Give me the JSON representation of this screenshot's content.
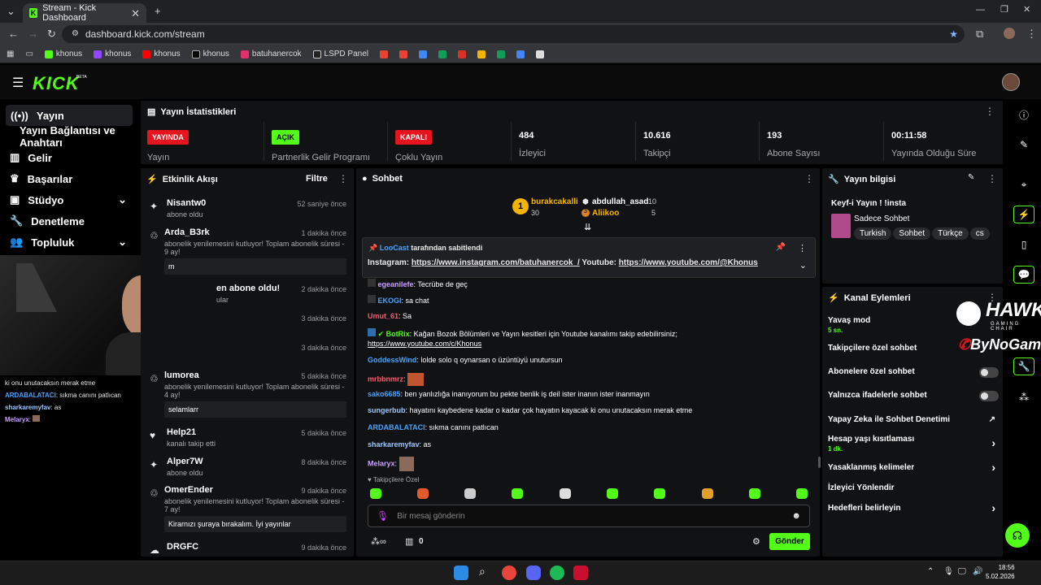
{
  "browser": {
    "tab_title": "Stream - Kick Dashboard",
    "url": "dashboard.kick.com/stream",
    "bookmarks": [
      "khonus",
      "khonus",
      "khonus",
      "khonus",
      "batuhanercok",
      "LSPD Panel"
    ]
  },
  "header": {
    "logo": "KICK",
    "beta": "BETA"
  },
  "sidebar": {
    "items": [
      {
        "label": "Yayın",
        "icon": "broadcast-icon"
      },
      {
        "label": "Yayın Bağlantısı ve Anahtarı",
        "icon": ""
      },
      {
        "label": "Gelir",
        "icon": "revenue-icon"
      },
      {
        "label": "Başarılar",
        "icon": "trophy-icon"
      },
      {
        "label": "Stüdyo",
        "icon": "studio-icon"
      },
      {
        "label": "Denetleme",
        "icon": "wrench-icon"
      },
      {
        "label": "Topluluk",
        "icon": "people-icon"
      }
    ],
    "overlay_chat": [
      {
        "user": "",
        "msg": "ki onu unutacaksın merak etme",
        "color": "#ffffff"
      },
      {
        "user": "ARDABALATACI",
        "msg": ": sıkma canını patlıcan",
        "color": "#4aa3ff"
      },
      {
        "user": "sharkaremyfav",
        "msg": ": as",
        "color": "#9ec7ff"
      },
      {
        "user": "Melaryx",
        "msg": ":",
        "color": "#c9a0ff"
      }
    ]
  },
  "stats": {
    "title": "Yayın İstatistikleri",
    "cells": [
      {
        "badge": "YAYINDA",
        "label": "Yayın",
        "badge_color": "#e5141f"
      },
      {
        "badge": "AÇIK",
        "label": "Partnerlik Gelir Programı",
        "badge_color": "#53fc18"
      },
      {
        "badge": "KAPALI",
        "label": "Çoklu Yayın",
        "badge_color": "#e5141f"
      },
      {
        "value": "484",
        "label": "İzleyici"
      },
      {
        "value": "10.616",
        "label": "Takipçi"
      },
      {
        "value": "193",
        "label": "Abone Sayısı"
      },
      {
        "value": "00:11:58",
        "label": "Yayında Olduğu Süre"
      }
    ]
  },
  "activity": {
    "title": "Etkinlik Akışı",
    "filter": "Filtre",
    "items": [
      {
        "name": "Nisantw0",
        "sub": "abone oldu",
        "time": "52 saniye önce"
      },
      {
        "name": "Arda_B3rk",
        "sub": "abonelik yenilemesini kutluyor! Toplam abonelik süresi - 9 ay!",
        "time": "1 dakika önce",
        "quote": "m"
      },
      {
        "name": "en abone oldu!",
        "sub": "ular",
        "time": "2 dakika önce"
      },
      {
        "name": "",
        "sub": "",
        "time": "3 dakika önce"
      },
      {
        "name": "",
        "sub": "",
        "time": "3 dakika önce"
      },
      {
        "name": "lumorea",
        "sub": "abonelik yenilemesini kutluyor! Toplam abonelik süresi - 4 ay!",
        "time": "5 dakika önce",
        "quote": "selamlarr"
      },
      {
        "name": "Help21",
        "sub": "kanalı takip etti",
        "time": "5 dakika önce"
      },
      {
        "name": "Alper7W",
        "sub": "abone oldu",
        "time": "8 dakika önce"
      },
      {
        "name": "OmerEnder",
        "sub": "abonelik yenilemesini kutluyor! Toplam abonelik süresi - 7 ay!",
        "time": "9 dakika önce",
        "quote": "Kirarnızı şuraya bırakalım. İyi yayınlar"
      },
      {
        "name": "DRGFC",
        "sub": "",
        "time": "9 dakika önce"
      }
    ]
  },
  "chat": {
    "title": "Sohbet",
    "leaders": [
      {
        "name": "burakcakalli",
        "count": "30",
        "rank": "1"
      },
      {
        "name": "abdullah_asad",
        "count": "10",
        "rank": ""
      },
      {
        "name": "Aliikoo",
        "count": "5",
        "rank": "3"
      }
    ],
    "pinned": {
      "by_user": "LooCast",
      "by_text": "tarafından sabitlendi",
      "prefix": "Instagram:",
      "link1": "https://www.instagram.com/batuhanercok_/",
      "mid": "Youtube:",
      "link2": "https://www.youtube.com/@Khonus"
    },
    "messages": [
      {
        "user": "egeanilefe",
        "text": ": Tecrübe de geç",
        "color": "#c9a0ff"
      },
      {
        "user": "EKOGI",
        "text": ": sa chat",
        "color": "#4aa3ff"
      },
      {
        "user": "Umut_61",
        "text": ": Sa",
        "color": "#ff5a6e"
      },
      {
        "user": "BotRix",
        "text": ": Kağan Bozok Bölümleri ve Yayın kesitleri için Youtube kanalımı takip edebilirsiniz;",
        "color": "#53fc18"
      },
      {
        "user": "",
        "text": "https://www.youtube.com/c/Khonus",
        "color": "#ffffff"
      },
      {
        "user": "GoddessWind",
        "text": ": lolde solo q oynarsan o üzüntüyü unutursun",
        "color": "#4aa3ff"
      },
      {
        "user": "mrbbnmrz",
        "text": ":",
        "color": "#ff5a6e"
      },
      {
        "user": "sako6685",
        "text": ": ben yanlızlığa inanıyorum bu pekte benlik iş deil ister inanın ister inanmayın",
        "color": "#4aa3ff"
      },
      {
        "user": "sungerbub",
        "text": ": hayatını kaybedene kadar o kadar çok hayatın kayacak ki onu unutacaksın merak etme",
        "color": "#9ec7ff"
      },
      {
        "user": "ARDABALATACI",
        "text": ": sıkma canını patlıcan",
        "color": "#4aa3ff"
      },
      {
        "user": "sharkaremyfav",
        "text": ": as",
        "color": "#9ec7ff"
      },
      {
        "user": "Melaryx",
        "text": ":",
        "color": "#c9a0ff"
      }
    ],
    "followers_only": "Takipçilere Özel",
    "input_placeholder": "Bir mesaj gönderin",
    "points": "0",
    "send": "Gönder"
  },
  "stream_info": {
    "title": "Yayın bilgisi",
    "stream_title": "Keyf-i Yayın ! !insta",
    "category": "Sadece Sohbet",
    "tags": [
      "Turkish",
      "Sohbet",
      "Türkçe",
      "cs"
    ]
  },
  "channel_actions": {
    "title": "Kanal Eylemleri",
    "rows": [
      {
        "label": "Yavaş mod",
        "sub": "5 sn."
      },
      {
        "label": "Takipçilere özel sohbet",
        "sub": ""
      },
      {
        "label": "Abonelere özel sohbet",
        "sub": ""
      },
      {
        "label": "Yalnızca ifadelerle sohbet",
        "sub": ""
      },
      {
        "label": "Yapay Zeka ile Sohbet Denetimi",
        "sub": ""
      },
      {
        "label": "Hesap yaşı kısıtlaması",
        "sub": "1 dk."
      },
      {
        "label": "Yasaklanmış kelimeler",
        "sub": ""
      },
      {
        "label": "İzleyici Yönlendir",
        "sub": ""
      },
      {
        "label": "Hedefleri belirleyin",
        "sub": ""
      }
    ]
  },
  "overlay_logos": {
    "hawk": "HAWK",
    "hawk_sub": "GAMING CHAIR",
    "bynogame": "ByNoGame"
  },
  "taskbar": {
    "time": "18:56",
    "date": "5.02.2026"
  }
}
